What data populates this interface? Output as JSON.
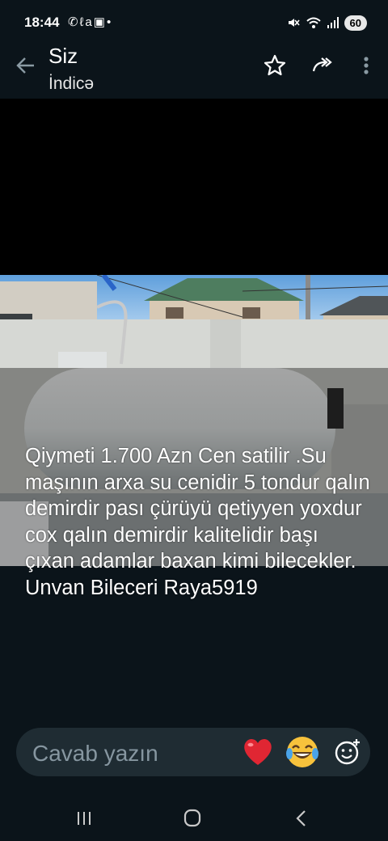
{
  "status_bar": {
    "time": "18:44",
    "left_icons": [
      "whatsapp-icon",
      "la-app-icon",
      "screenshot-icon",
      "dot-icon"
    ],
    "right_icons": [
      "mute-icon",
      "wifi-icon",
      "signal-icon"
    ],
    "battery": "60"
  },
  "header": {
    "back_icon": "arrow-back-icon",
    "sender": "Siz",
    "subtitle": "İndicə",
    "actions": [
      "star-icon",
      "forward-icon",
      "more-vert-icon"
    ]
  },
  "status": {
    "caption": "Qiymeti 1.700 Azn Cen satilir .Su maşının arxa su cenidir 5 tondur qalın demirdir pası çürüyü qetiyyen yoxdur cox qalın demirdir kalitelidir başı çıxan adamlar baxan kimi bilecekler. Unvan Bileceri Raya5919"
  },
  "reply": {
    "placeholder": "Cavab yazın",
    "reactions": [
      "red-heart",
      "face-with-tears-of-joy"
    ],
    "emoji_icon": "add-emoji-icon"
  },
  "nav": [
    "recent-apps-icon",
    "home-icon",
    "back-icon"
  ],
  "colors": {
    "background": "#0b141a",
    "reply_bar": "#1f2c33",
    "placeholder": "#8696a0"
  }
}
